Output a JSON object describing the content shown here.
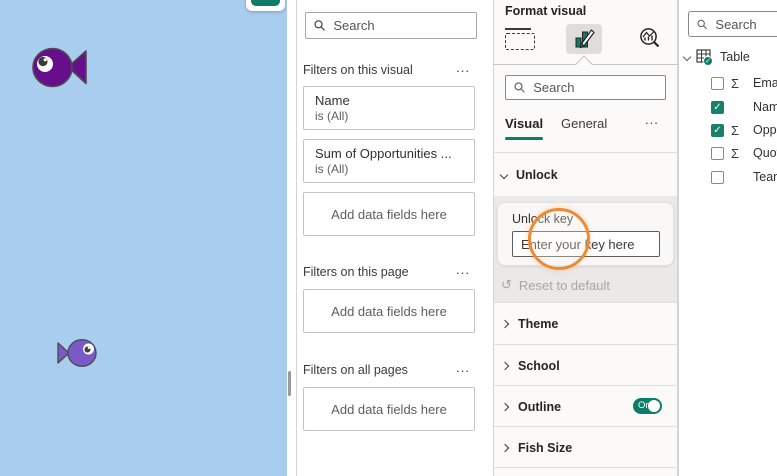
{
  "canvas": {
    "background_color": "#A9CDEE",
    "fish": [
      {
        "name": "large-fish",
        "color": "#670E8C",
        "facing": "left"
      },
      {
        "name": "small-fish",
        "color": "#7A5AC8",
        "facing": "right"
      }
    ]
  },
  "filters_pane": {
    "search_placeholder": "Search",
    "more_label": "...",
    "add_fields_label": "Add data fields here",
    "sections": [
      {
        "title": "Filters on this visual"
      },
      {
        "title": "Filters on this page"
      },
      {
        "title": "Filters on all pages"
      }
    ],
    "visual_filters": [
      {
        "field": "Name",
        "condition": "is (All)"
      },
      {
        "field": "Sum of Opportunities ...",
        "condition": "is (All)"
      }
    ]
  },
  "format_pane": {
    "title": "Format visual",
    "icon_names": [
      "build-visual-icon",
      "format-visual-icon",
      "analytics-icon"
    ],
    "search_placeholder": "Search",
    "tabs": [
      {
        "label": "Visual",
        "active": true
      },
      {
        "label": "General",
        "active": false
      }
    ],
    "more_label": "...",
    "unlock_section": {
      "title": "Unlock",
      "key_label": "Unlock key",
      "key_placeholder": "Enter your key here",
      "reset_label": "Reset to default",
      "reset_icon": "↺"
    },
    "cards": [
      {
        "label": "Theme"
      },
      {
        "label": "School"
      },
      {
        "label": "Outline",
        "toggle": "On"
      },
      {
        "label": "Fish Size"
      }
    ]
  },
  "data_pane": {
    "search_placeholder": "Search",
    "table_name": "Table",
    "sigma_glyph": "Σ",
    "check_glyph": "✓",
    "fields": [
      {
        "label": "Email",
        "checked": false,
        "aggregate": true
      },
      {
        "label": "Name",
        "checked": true,
        "aggregate": false
      },
      {
        "label": "Opportunities",
        "checked": true,
        "aggregate": true
      },
      {
        "label": "Quota",
        "checked": false,
        "aggregate": true
      },
      {
        "label": "Team",
        "checked": false,
        "aggregate": false
      }
    ]
  },
  "annotation": {
    "type": "click-highlight-circle",
    "color": "#EC8B33"
  },
  "colors": {
    "accent_teal": "#0E7C68",
    "canvas_blue": "#A9CDEE",
    "fish_large_purple": "#670E8C",
    "fish_small_purple": "#7A5AC8",
    "annotation_orange": "#EC8B33"
  }
}
